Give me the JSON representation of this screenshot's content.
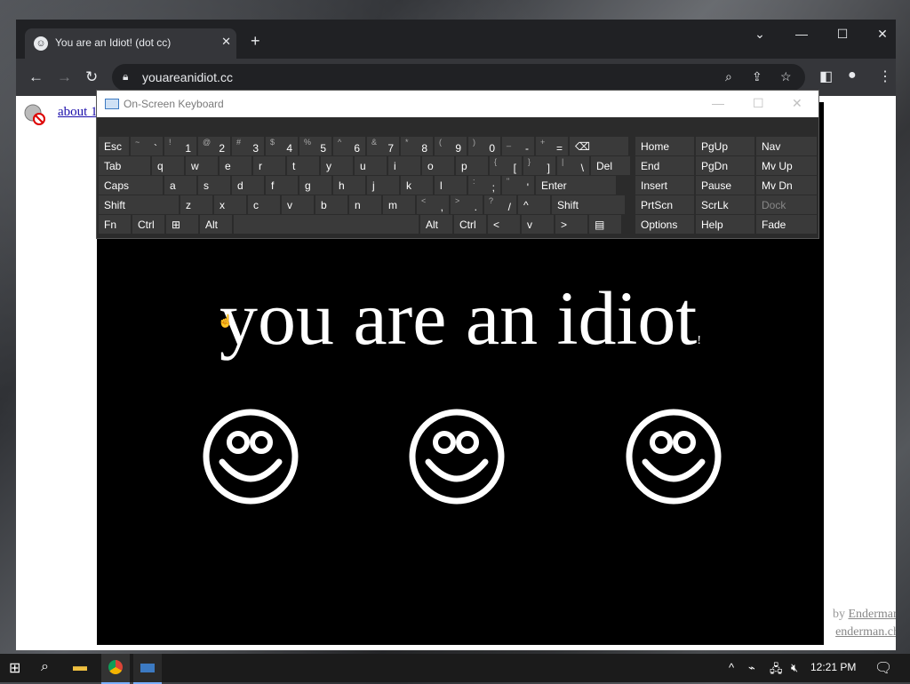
{
  "browser": {
    "tab_title": "You are an Idiot! (dot cc)",
    "url": "youareanidiot.cc"
  },
  "page": {
    "about_link": "about 1",
    "credit_line1_prefix": "by ",
    "credit_line1_link": "Enderman",
    "credit_line2_link": "enderman.ch"
  },
  "popup": {
    "headline": "you are an idiot",
    "headline_suffix": "!"
  },
  "osk": {
    "title": "On-Screen Keyboard",
    "rows": [
      [
        {
          "l": "Esc"
        },
        {
          "s": "~",
          "l": "`"
        },
        {
          "s": "!",
          "l": "1"
        },
        {
          "s": "@",
          "l": "2"
        },
        {
          "s": "#",
          "l": "3"
        },
        {
          "s": "$",
          "l": "4"
        },
        {
          "s": "%",
          "l": "5"
        },
        {
          "s": "^",
          "l": "6"
        },
        {
          "s": "&",
          "l": "7"
        },
        {
          "s": "*",
          "l": "8"
        },
        {
          "s": "(",
          "l": "9"
        },
        {
          "s": ")",
          "l": "0"
        },
        {
          "s": "_",
          "l": "-"
        },
        {
          "s": "+",
          "l": "="
        },
        {
          "l": "⌫"
        }
      ],
      [
        {
          "l": "Tab"
        },
        {
          "l": "q"
        },
        {
          "l": "w"
        },
        {
          "l": "e"
        },
        {
          "l": "r"
        },
        {
          "l": "t"
        },
        {
          "l": "y"
        },
        {
          "l": "u"
        },
        {
          "l": "i"
        },
        {
          "l": "o"
        },
        {
          "l": "p"
        },
        {
          "s": "{",
          "l": "["
        },
        {
          "s": "}",
          "l": "]"
        },
        {
          "s": "|",
          "l": "\\"
        },
        {
          "l": "Del"
        }
      ],
      [
        {
          "l": "Caps"
        },
        {
          "l": "a"
        },
        {
          "l": "s"
        },
        {
          "l": "d"
        },
        {
          "l": "f"
        },
        {
          "l": "g"
        },
        {
          "l": "h"
        },
        {
          "l": "j"
        },
        {
          "l": "k"
        },
        {
          "l": "l"
        },
        {
          "s": ":",
          "l": ";"
        },
        {
          "s": "\"",
          "l": "'"
        },
        {
          "l": "Enter"
        }
      ],
      [
        {
          "l": "Shift"
        },
        {
          "l": "z"
        },
        {
          "l": "x"
        },
        {
          "l": "c"
        },
        {
          "l": "v"
        },
        {
          "l": "b"
        },
        {
          "l": "n"
        },
        {
          "l": "m"
        },
        {
          "s": "<",
          "l": ","
        },
        {
          "s": ">",
          "l": "."
        },
        {
          "s": "?",
          "l": "/"
        },
        {
          "l": "^"
        },
        {
          "l": "Shift"
        }
      ],
      [
        {
          "l": "Fn"
        },
        {
          "l": "Ctrl"
        },
        {
          "l": "⊞"
        },
        {
          "l": "Alt"
        },
        {
          "l": ""
        },
        {
          "l": "Alt"
        },
        {
          "l": "Ctrl"
        },
        {
          "l": "<"
        },
        {
          "l": "v"
        },
        {
          "l": ">"
        },
        {
          "l": "▤"
        }
      ]
    ],
    "side": [
      [
        "Home",
        "PgUp",
        "Nav"
      ],
      [
        "End",
        "PgDn",
        "Mv Up"
      ],
      [
        "Insert",
        "Pause",
        "Mv Dn"
      ],
      [
        "PrtScn",
        "ScrLk",
        "Dock"
      ],
      [
        "Options",
        "Help",
        "Fade"
      ]
    ]
  },
  "taskbar": {
    "time": "12:21 PM"
  }
}
